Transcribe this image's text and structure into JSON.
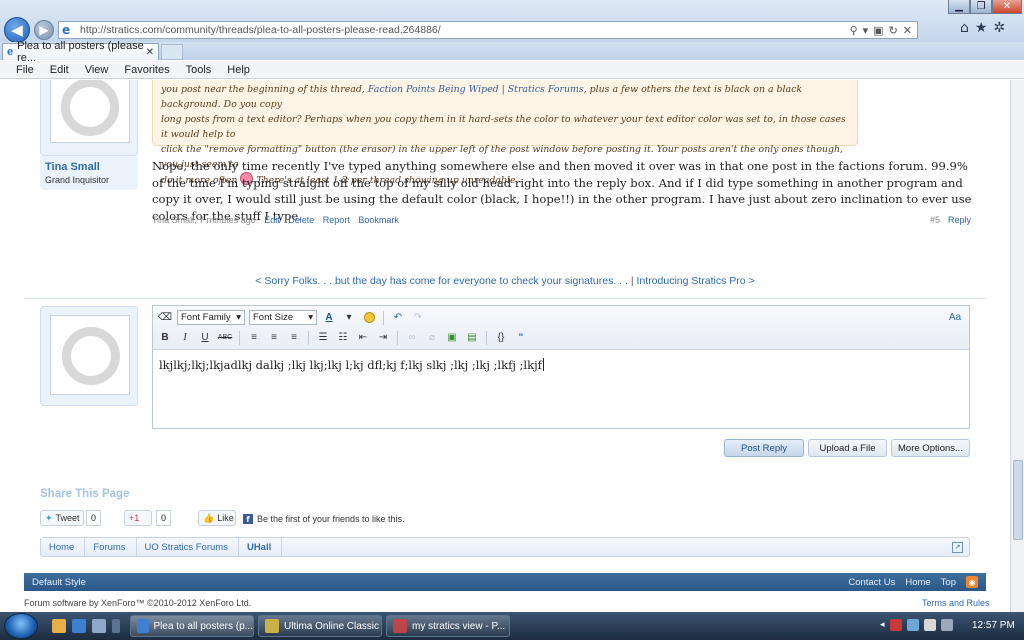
{
  "browser": {
    "url": "http://stratics.com/community/threads/plea-to-all-posters-please-read.264886/",
    "tab_title": "Plea to all posters (please re...",
    "tab_close": "✕",
    "menu": [
      "File",
      "Edit",
      "View",
      "Favorites",
      "Tools",
      "Help"
    ]
  },
  "quote": {
    "line1_pre": "you post near the beginning of this thread, ",
    "line1_link": "Faction Points Being Wiped | Stratics Forums",
    "line1_post": ", plus a few others the text is black on a black background. Do you copy",
    "line2": "long posts from a text editor? Perhaps when you copy them in it hard-sets the color to whatever your text editor color was set to, in those cases it would help to",
    "line3": "click the \"remove formatting\" button (the erasor) in the upper left of the post window before posting it. Your posts aren't the only ones though, you just seem to",
    "line4_pre": "do it more often",
    "line4_post": "There's at least 1-2 per thread showing up unreadable."
  },
  "post": {
    "username": "Tina Small",
    "user_title": "Grand Inquisitor",
    "body": "Nope, the only time recently I've typed anything somewhere else and then moved it over was in that one post in the factions forum. 99.9% of the time I'm typing straight off the top of my silly old head right into the reply box. And if I did type something in another program and copy it over, I would still just be using the default color (black, I hope!!) in the other program. I have just about zero inclination to ever use colors for the stuff I type.",
    "meta": "Tina Small, 7 minutes ago",
    "actions": [
      "Edit",
      "Delete",
      "Report",
      "Bookmark"
    ],
    "number": "#5",
    "reply_label": "Reply"
  },
  "thread_nav": {
    "prev": "< Sorry Folks. . . but the day has come for everyone to check your signatures. . .",
    "separator": "|",
    "next": "Introducing Stratics Pro >"
  },
  "editor": {
    "font_family": "Font Family",
    "font_size": "Font Size",
    "content": "lkjlkj;lkj;lkjadlkj dalkj ;lkj lkj;lkj l;kj dfl;kj f;lkj slkj ;lkj ;lkj ;lkfj ;lkjf",
    "toolbar_row1": [
      "eraser-icon",
      "font-family-select",
      "font-size-select",
      "text-color-icon",
      "smiley-icon",
      "undo-icon",
      "redo-icon"
    ],
    "toolbar_row2": [
      "B",
      "I",
      "U",
      "ABC"
    ]
  },
  "buttons": {
    "post_reply": "Post Reply",
    "upload": "Upload a File",
    "more": "More Options..."
  },
  "share": {
    "title": "Share This Page",
    "tweet": "Tweet",
    "tweet_count": "0",
    "gplus": "+1",
    "gplus_count": "0",
    "like": "Like",
    "fb_text": "Be the first of your friends to like this."
  },
  "breadcrumb": [
    "Home",
    "Forums",
    "UO Stratics Forums",
    "UHall"
  ],
  "footer": {
    "style": "Default Style",
    "links": [
      "Contact Us",
      "Home",
      "Top"
    ],
    "copyright": "Forum software by XenForo™ ©2010-2012 XenForo Ltd.",
    "terms": "Terms and Rules"
  },
  "taskbar": {
    "tasks": [
      "Plea to all posters (p...",
      "Ultima Online Classic",
      "my stratics view - P..."
    ],
    "clock": "12:57 PM"
  }
}
